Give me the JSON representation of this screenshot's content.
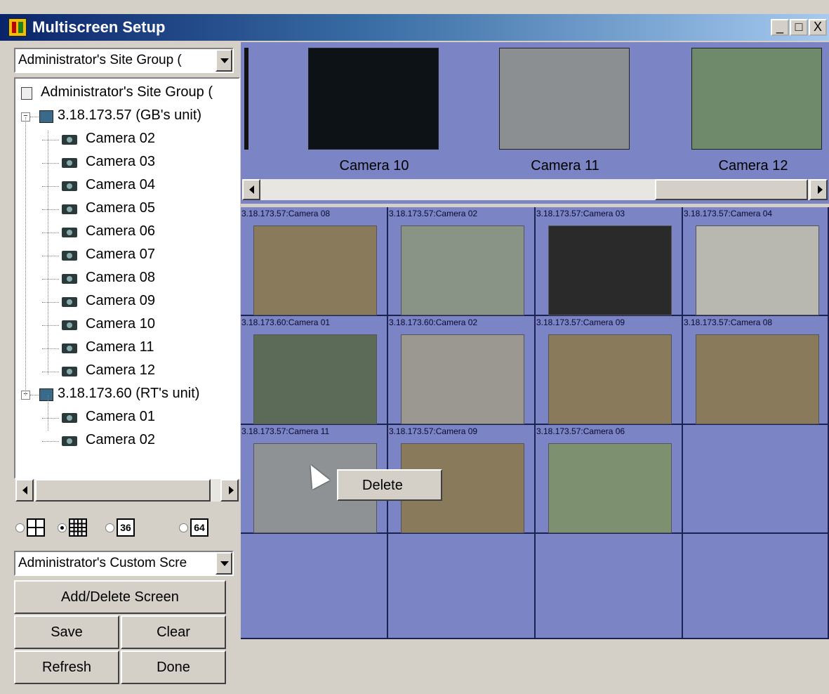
{
  "window": {
    "title": "Multiscreen Setup",
    "minimize": "_",
    "maximize": "□",
    "close": "X"
  },
  "site_combo": {
    "value": "Administrator's Site Group ("
  },
  "tree": {
    "root": "Administrator's Site Group (",
    "units": [
      {
        "label": "3.18.173.57 (GB's unit)",
        "cameras": [
          "Camera 02",
          "Camera 03",
          "Camera 04",
          "Camera 05",
          "Camera 06",
          "Camera 07",
          "Camera 08",
          "Camera 09",
          "Camera 10",
          "Camera 11",
          "Camera 12"
        ]
      },
      {
        "label": "3.18.173.60 (RT's unit)",
        "cameras": [
          "Camera 01",
          "Camera 02"
        ]
      }
    ]
  },
  "layout_options": [
    {
      "icon": "grid-2x2-icon",
      "selected": false,
      "label": ""
    },
    {
      "icon": "grid-4x4-icon",
      "selected": true,
      "label": ""
    },
    {
      "icon": "grid-36-icon",
      "selected": false,
      "label": "36"
    },
    {
      "icon": "grid-64-icon",
      "selected": false,
      "label": "64"
    }
  ],
  "screen_combo": {
    "value": "Administrator's Custom Scre"
  },
  "buttons": {
    "add_delete": "Add/Delete Screen",
    "save": "Save",
    "clear": "Clear",
    "refresh": "Refresh",
    "done": "Done"
  },
  "strip": {
    "thumbs": [
      {
        "label": "Camera 10",
        "color": "#0d1216"
      },
      {
        "label": "Camera 11",
        "color": "#8b8f92"
      },
      {
        "label": "Camera 12",
        "color": "#6f8a6a"
      }
    ]
  },
  "grid": {
    "cells": [
      {
        "label": "3.18.173.57:Camera 08",
        "color": "#8a7a5c"
      },
      {
        "label": "3.18.173.57:Camera 02",
        "color": "#8a9486"
      },
      {
        "label": "3.18.173.57:Camera 03",
        "color": "#2a2a2a"
      },
      {
        "label": "3.18.173.57:Camera 04",
        "color": "#b8b8b0"
      },
      {
        "label": "3.18.173.60:Camera 01",
        "color": "#5c6a58"
      },
      {
        "label": "3.18.173.60:Camera 02",
        "color": "#9a9890"
      },
      {
        "label": "3.18.173.57:Camera 09",
        "color": "#8a7a5c"
      },
      {
        "label": "3.18.173.57:Camera 08",
        "color": "#8a7a5c"
      },
      {
        "label": "3.18.173.57:Camera 11",
        "color": "#8e9294"
      },
      {
        "label": "3.18.173.57:Camera 09",
        "color": "#8a7a5c"
      },
      {
        "label": "3.18.173.57:Camera 06",
        "color": "#7d9070"
      },
      {
        "label": "",
        "color": ""
      },
      {
        "label": "",
        "color": ""
      },
      {
        "label": "",
        "color": ""
      },
      {
        "label": "",
        "color": ""
      },
      {
        "label": "",
        "color": ""
      }
    ]
  },
  "context_menu": {
    "item": "Delete"
  },
  "colors": {
    "panel_bg": "#7b84c4",
    "title_gradient_start": "#0a246a",
    "window_bg": "#d4d0c8"
  }
}
